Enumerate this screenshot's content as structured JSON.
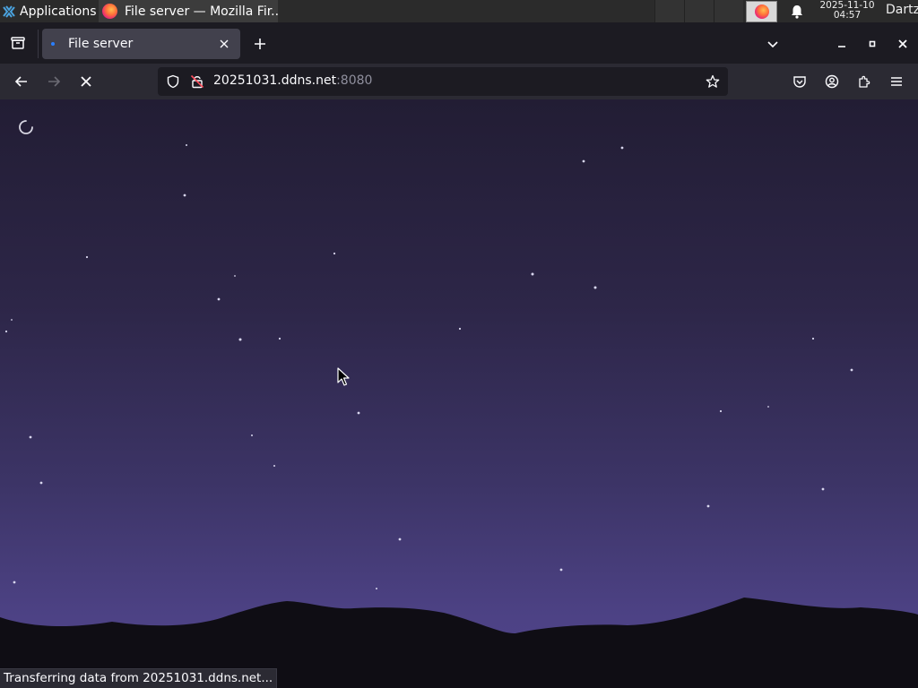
{
  "taskbar": {
    "apps_label": "Applications",
    "apps_icon": "xfce-logo-icon",
    "window_title": "File server — Mozilla Fir...",
    "clock_date": "2025-11-10",
    "clock_time": "04:57",
    "user": "Dartz"
  },
  "browser": {
    "tab_title": "File server",
    "url_host": "20251031.ddns.net",
    "url_port": ":8080",
    "status_text": "Transferring data from 20251031.ddns.net...",
    "loading": true
  },
  "colors": {
    "sky_top": "#221d34",
    "sky_bottom": "#4f4588",
    "mountains": "#0f0d14",
    "tab_active": "#42414d",
    "toolbar": "#2b2a33"
  }
}
